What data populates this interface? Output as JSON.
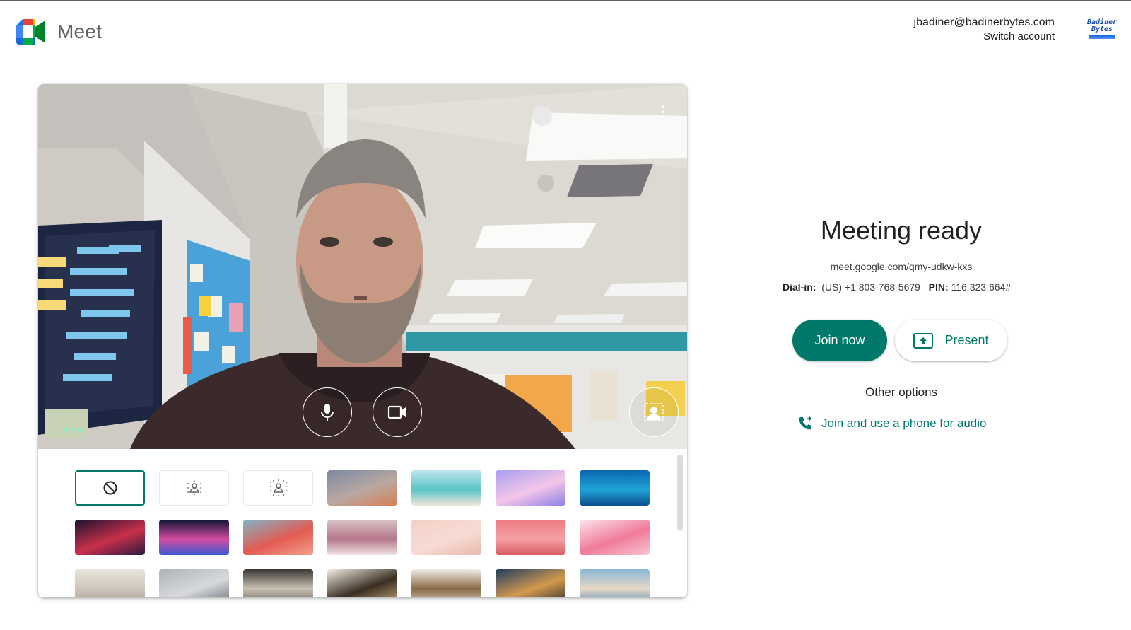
{
  "app": {
    "name": "Meet"
  },
  "account": {
    "email": "jbadiner@badinerbytes.com",
    "switch_label": "Switch account",
    "org_logo_text": "Badiner Bytes"
  },
  "preview": {
    "mic_icon": "mic-icon",
    "camera_icon": "videocam-icon",
    "effects_icon": "visual-effects-icon",
    "more_icon": "more-vert-icon"
  },
  "backgrounds": {
    "items": [
      {
        "name": "no-effect",
        "kind": "icon"
      },
      {
        "name": "slight-blur",
        "kind": "icon"
      },
      {
        "name": "blur",
        "kind": "icon"
      },
      {
        "name": "sunset-gradient",
        "kind": "image",
        "colors": [
          "#7c8aa3",
          "#b8a8a0",
          "#d97e54"
        ]
      },
      {
        "name": "beach",
        "kind": "image",
        "colors": [
          "#bfe6f1",
          "#58c5c4",
          "#f0e6dc"
        ]
      },
      {
        "name": "clouds",
        "kind": "image",
        "colors": [
          "#a89ef0",
          "#f4c6e8",
          "#8f7fe8"
        ]
      },
      {
        "name": "underwater",
        "kind": "image",
        "colors": [
          "#0a66b0",
          "#1fa3d6",
          "#0d4f90"
        ]
      },
      {
        "name": "nebula",
        "kind": "image",
        "colors": [
          "#1a1230",
          "#c8304a",
          "#2a1a40"
        ]
      },
      {
        "name": "fireworks",
        "kind": "image",
        "colors": [
          "#0d1535",
          "#d44aa0",
          "#3a5ad4"
        ]
      },
      {
        "name": "flowers",
        "kind": "image",
        "colors": [
          "#7fb5c8",
          "#e35b52",
          "#f1a08c"
        ]
      },
      {
        "name": "roses",
        "kind": "image",
        "colors": [
          "#d8c3c6",
          "#b5768a",
          "#f1e3e4"
        ]
      },
      {
        "name": "pink-confetti",
        "kind": "image",
        "colors": [
          "#f3cfc6",
          "#f7dcd4",
          "#eab8ad"
        ]
      },
      {
        "name": "pink-grid",
        "kind": "image",
        "colors": [
          "#ef7b82",
          "#f4a1a4",
          "#d95a66"
        ]
      },
      {
        "name": "petals",
        "kind": "image",
        "colors": [
          "#fbe4ea",
          "#f07a9a",
          "#f9c5d2"
        ]
      },
      {
        "name": "gallery-room",
        "kind": "image",
        "colors": [
          "#e9e4de",
          "#cfc6bb",
          "#a89d91"
        ]
      },
      {
        "name": "office",
        "kind": "image",
        "colors": [
          "#aeb1b6",
          "#d7d9dc",
          "#6e7278"
        ]
      },
      {
        "name": "loft",
        "kind": "image",
        "colors": [
          "#3a3633",
          "#c9c1b3",
          "#6d665e"
        ]
      },
      {
        "name": "bookshelf",
        "kind": "image",
        "colors": [
          "#f3ede3",
          "#3a2e22",
          "#c7a87c"
        ]
      },
      {
        "name": "shelves",
        "kind": "image",
        "colors": [
          "#f1ede7",
          "#8a6a46",
          "#d6cabb"
        ]
      },
      {
        "name": "cabin",
        "kind": "image",
        "colors": [
          "#1f3c63",
          "#d49a4d",
          "#2b2b2b"
        ]
      },
      {
        "name": "coast",
        "kind": "image",
        "colors": [
          "#8cb7d6",
          "#e8d9c6",
          "#5b8fb8"
        ]
      }
    ]
  },
  "meeting": {
    "title": "Meeting ready",
    "url": "meet.google.com/qmy-udkw-kxs",
    "dialin_label": "Dial-in:",
    "dialin_number": "(US) +1 803-768-5679",
    "pin_label": "PIN:",
    "pin_value": "116 323 664#"
  },
  "actions": {
    "join_label": "Join now",
    "present_label": "Present",
    "other_options_label": "Other options",
    "phone_audio_label": "Join and use a phone for audio"
  },
  "colors": {
    "accent": "#00796b",
    "text": "#202124"
  }
}
